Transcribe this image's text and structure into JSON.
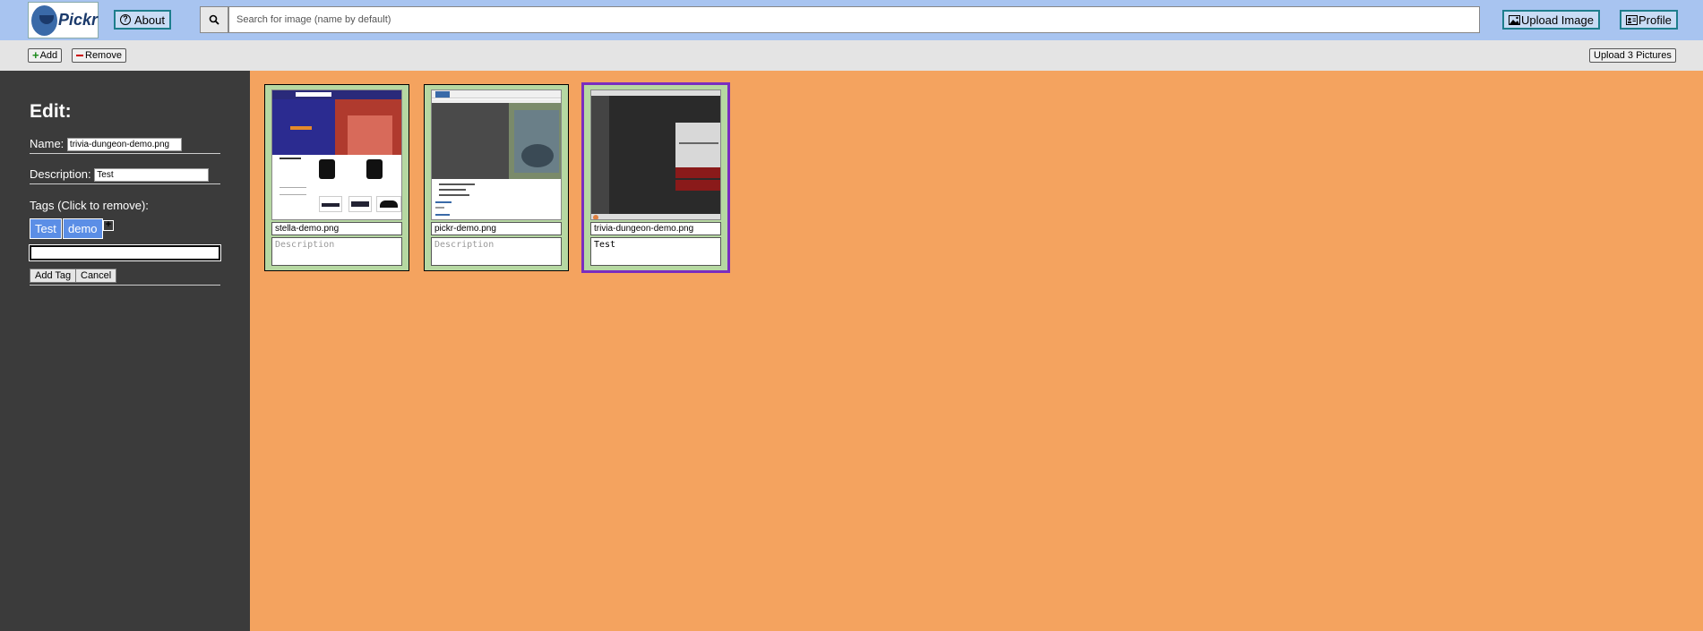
{
  "header": {
    "logo_text": "Pickr",
    "about_label": "About",
    "search_placeholder": "Search for image (name by default)",
    "upload_label": "Upload Image",
    "profile_label": "Profile"
  },
  "toolbar": {
    "add_label": "Add",
    "remove_label": "Remove",
    "upload_pictures_label": "Upload 3 Pictures"
  },
  "sidebar": {
    "title": "Edit:",
    "name_label": "Name:",
    "name_value": "trivia-dungeon-demo.png",
    "description_label": "Description:",
    "description_value": "Test",
    "tags_label": "Tags (Click to remove):",
    "tags": [
      "Test",
      "demo"
    ],
    "add_tag_label": "Add Tag",
    "cancel_label": "Cancel"
  },
  "cards": [
    {
      "name": "stella-demo.png",
      "description": "",
      "placeholder": "Description",
      "selected": false
    },
    {
      "name": "pickr-demo.png",
      "description": "",
      "placeholder": "Description",
      "selected": false
    },
    {
      "name": "trivia-dungeon-demo.png",
      "description": "Test",
      "placeholder": "Description",
      "selected": true
    }
  ],
  "colors": {
    "header_bg": "#a8c4f0",
    "sidebar_bg": "#3b3b3b",
    "main_bg": "#f4a35f",
    "card_bg": "#b6d8a2",
    "tag_bg": "#5b8ee6",
    "selected_border": "#7a2dbf"
  }
}
